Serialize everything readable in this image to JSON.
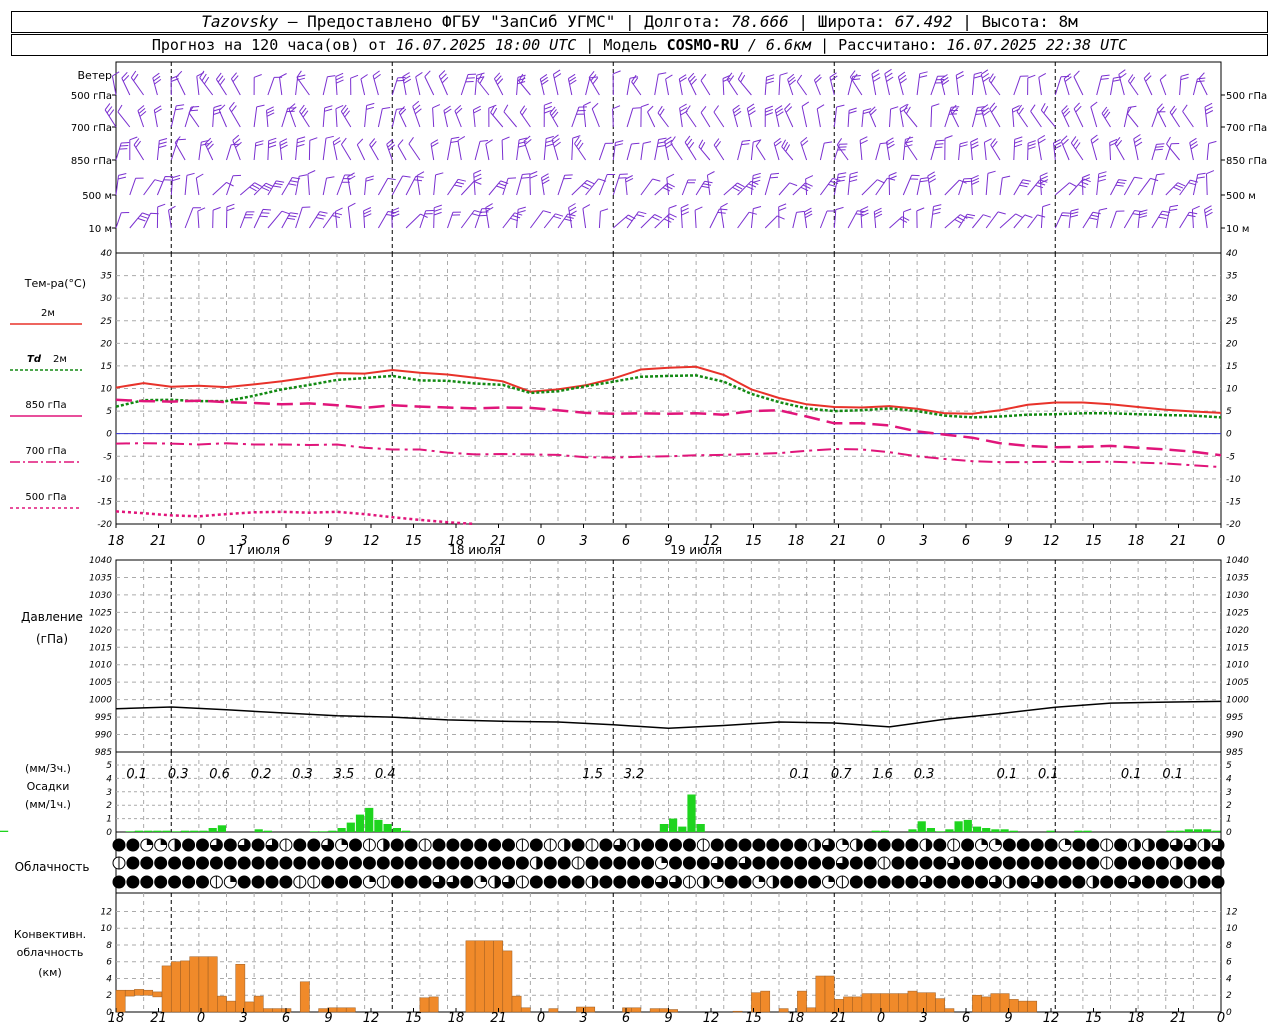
{
  "header": {
    "station": "Tazovsky",
    "provider": " — Предоставлено ФГБУ \"ЗапСиб УГМС\" | Долгота: ",
    "lon": "78.666",
    "lat_label": " | Широта: ",
    "lat": "67.492",
    "alt_label": " | Высота: 8м",
    "forecast_label": "Прогноз на 120 часа(ов) от ",
    "forecast_time": "16.07.2025 18:00 UTC",
    "model_label": " | Модель ",
    "model": "COSMO-RU",
    "model_res": " / 6.6км",
    "calc_label": " | Рассчитано: ",
    "calc_time": "16.07.2025 22:38 UTC"
  },
  "labels": {
    "wind": "Ветер",
    "wind_levels": [
      "500 гПа",
      "700 гПа",
      "850 гПа",
      "500 м",
      "10 м"
    ],
    "temp": "Тем-ра(°C)",
    "t2m": "2м",
    "td": "Td",
    "td2m": "2м",
    "t850": "850 гПа",
    "t700": "700 гПа",
    "t500": "500 гПа",
    "pressure": "Давление",
    "pressure_unit": "(гПа)",
    "precip_unit3": "(мм/3ч.)",
    "precip": "Осадки",
    "precip_unit1": "(мм/1ч.)",
    "cloud": "Облачность",
    "conv1": "Конвективн.",
    "conv2": "облачность",
    "conv3": "(км)"
  },
  "x_ticks": [
    "18",
    "21",
    "0",
    "3",
    "6",
    "9",
    "12",
    "15",
    "18",
    "21",
    "0",
    "3",
    "6",
    "9",
    "12",
    "15",
    "18",
    "21",
    "0",
    "3",
    "6",
    "9",
    "12",
    "15",
    "18",
    "21",
    "0"
  ],
  "days": [
    "17 июля",
    "18 июля",
    "19 июля"
  ],
  "colors": {
    "wind": "#7a2fd0",
    "t2m": "#e8322a",
    "td": "#138a13",
    "upper": "#e0157a",
    "precip": "#1ed41e",
    "conv": "#f08a2a",
    "zero": "#3030d0"
  },
  "chart_data": [
    {
      "type": "line",
      "title": "Тем-ра(°C)",
      "x_hours": [
        0,
        3,
        6,
        9,
        12,
        15,
        18,
        21,
        24,
        27,
        30,
        33,
        36,
        39,
        42,
        45,
        48,
        51,
        54,
        57,
        60,
        63,
        66,
        69,
        72,
        75,
        78,
        81,
        84,
        87,
        90,
        93,
        96,
        99,
        102,
        105,
        108,
        111,
        114,
        117,
        120
      ],
      "ylim": [
        -20,
        40
      ],
      "series": [
        {
          "name": "2м",
          "values": [
            10.2,
            11.2,
            10.4,
            10.6,
            10.3,
            10.9,
            11.6,
            12.5,
            13.4,
            13.3,
            14.1,
            13.5,
            13.1,
            12.4,
            11.6,
            9.3,
            9.8,
            10.7,
            12.2,
            14.2,
            14.6,
            14.8,
            13.0,
            9.8,
            7.9,
            6.5,
            5.9,
            5.8,
            6.1,
            5.5,
            4.5,
            4.4,
            5.2,
            6.4,
            6.9,
            6.9,
            6.5,
            5.9,
            5.3,
            4.9,
            4.6
          ]
        },
        {
          "name": "Td 2м",
          "values": [
            6.0,
            7.4,
            7.5,
            7.2,
            7.2,
            8.4,
            9.8,
            10.8,
            11.9,
            12.3,
            12.8,
            11.8,
            11.7,
            11.1,
            10.8,
            9.0,
            9.4,
            10.5,
            11.5,
            12.6,
            12.8,
            12.9,
            11.5,
            8.8,
            7.0,
            5.6,
            5.0,
            5.2,
            5.6,
            5.0,
            4.0,
            3.6,
            3.8,
            4.2,
            4.3,
            4.5,
            4.5,
            4.3,
            4.1,
            4.0,
            3.6
          ]
        },
        {
          "name": "850 гПа",
          "values": [
            7.5,
            7.2,
            7.1,
            7.3,
            7.0,
            6.8,
            6.5,
            6.7,
            6.3,
            5.7,
            6.3,
            6.0,
            5.8,
            5.6,
            5.8,
            5.7,
            5.2,
            4.6,
            4.4,
            4.5,
            4.4,
            4.5,
            4.2,
            5.0,
            5.2,
            3.8,
            2.3,
            2.3,
            1.8,
            0.5,
            -0.2,
            -0.9,
            -2.1,
            -2.7,
            -3.0,
            -2.9,
            -2.7,
            -3.1,
            -3.5,
            -4.0,
            -4.8
          ]
        },
        {
          "name": "700 гПа",
          "values": [
            -2.2,
            -2.1,
            -2.2,
            -2.4,
            -2.1,
            -2.4,
            -2.4,
            -2.5,
            -2.4,
            -3.1,
            -3.5,
            -3.5,
            -4.2,
            -4.6,
            -4.5,
            -4.6,
            -4.7,
            -5.2,
            -5.3,
            -5.1,
            -5.0,
            -4.8,
            -4.7,
            -4.5,
            -4.3,
            -3.8,
            -3.4,
            -3.5,
            -4.1,
            -5.0,
            -5.6,
            -6.1,
            -6.3,
            -6.3,
            -6.2,
            -6.3,
            -6.2,
            -6.4,
            -6.6,
            -7.0,
            -7.4
          ]
        },
        {
          "name": "500 гПа",
          "values": [
            -17.2,
            -17.6,
            -18.1,
            -18.3,
            -17.8,
            -17.4,
            -17.3,
            -17.5,
            -17.3,
            -17.8,
            -18.5,
            -19.1,
            -19.6,
            -20.0
          ]
        }
      ]
    },
    {
      "type": "line",
      "title": "Давление",
      "ylabel": "(гПа)",
      "x_hours": [
        0,
        6,
        12,
        18,
        24,
        30,
        36,
        42,
        48,
        54,
        60,
        66,
        72,
        78,
        84,
        90,
        96,
        102,
        108,
        114,
        120
      ],
      "ylim": [
        985,
        1040
      ],
      "series": [
        {
          "name": "Давление",
          "values": [
            997.4,
            997.9,
            997.1,
            996.2,
            995.4,
            995.0,
            994.2,
            993.8,
            993.6,
            992.8,
            991.8,
            992.6,
            993.6,
            993.3,
            992.2,
            994.4,
            996.0,
            997.8,
            999.0,
            999.3,
            999.5
          ]
        }
      ]
    },
    {
      "type": "bar",
      "title": "Осадки",
      "x_hours": [
        0,
        1,
        2,
        3,
        4,
        5,
        6,
        7,
        8,
        9,
        10,
        11,
        12,
        13,
        14,
        15,
        16,
        17,
        18,
        19,
        20,
        21,
        22,
        23,
        24,
        25,
        26,
        27,
        28,
        29,
        30,
        31,
        32,
        33,
        34,
        35,
        36,
        37,
        38,
        39,
        40,
        41,
        42,
        43,
        44,
        45,
        46,
        47,
        48,
        49,
        50,
        51,
        52,
        53,
        54,
        55,
        56,
        57,
        58,
        59,
        60,
        61,
        62,
        63,
        64,
        65,
        66,
        67,
        68,
        69,
        70,
        71,
        72,
        73,
        74,
        75,
        76,
        77,
        78,
        79,
        80,
        81,
        82,
        83,
        84,
        85,
        86,
        87,
        88,
        89,
        90,
        91,
        92,
        93,
        94,
        95,
        96,
        97,
        98,
        99,
        100,
        101,
        102,
        103,
        104,
        105,
        106,
        107,
        108,
        109,
        110,
        111,
        112,
        113,
        114,
        115,
        116,
        117,
        118,
        119
      ],
      "ylim": [
        0,
        5
      ],
      "values": [
        0,
        0.05,
        0.1,
        0.1,
        0.1,
        0.1,
        0.05,
        0.1,
        0.1,
        0.1,
        0.3,
        0.5,
        0,
        0,
        0,
        0.2,
        0.1,
        0,
        0,
        0,
        0,
        0.05,
        0.05,
        0.1,
        0.3,
        0.7,
        1.3,
        1.8,
        0.9,
        0.6,
        0.3,
        0.1,
        0,
        0,
        0,
        0,
        0,
        0,
        0,
        0,
        0,
        0,
        0,
        0,
        0,
        0,
        0,
        0,
        0,
        0,
        0,
        0,
        0,
        0,
        0,
        0,
        0,
        0,
        0,
        0.6,
        1.0,
        0.4,
        2.8,
        0.6,
        0,
        0,
        0,
        0,
        0,
        0,
        0,
        0,
        0,
        0,
        0,
        0,
        0,
        0,
        0,
        0,
        0,
        0,
        0.1,
        0.1,
        0,
        0,
        0.2,
        0.8,
        0.3,
        0.05,
        0.2,
        0.8,
        0.9,
        0.4,
        0.3,
        0.2,
        0.2,
        0.1,
        0,
        0,
        0,
        0.1,
        0,
        0,
        0.1,
        0.1,
        0,
        0,
        0,
        0,
        0,
        0,
        0,
        0,
        0.1,
        0.1,
        0.2,
        0.2,
        0.2,
        0.1,
        0.1,
        0
      ],
      "labels": [
        {
          "x_hours": 1.5,
          "text": "0.1"
        },
        {
          "x_hours": 4.5,
          "text": "0.3"
        },
        {
          "x_hours": 7.5,
          "text": "0.6"
        },
        {
          "x_hours": 10.5,
          "text": "0.2"
        },
        {
          "x_hours": 13.5,
          "text": "0.3"
        },
        {
          "x_hours": 16.5,
          "text": "3.5"
        },
        {
          "x_hours": 19.5,
          "text": "0.4"
        },
        {
          "x_hours": 34.5,
          "text": "1.5"
        },
        {
          "x_hours": 37.5,
          "text": "3.2"
        },
        {
          "x_hours": 49.5,
          "text": "0.1"
        },
        {
          "x_hours": 52.5,
          "text": "0.7"
        },
        {
          "x_hours": 55.5,
          "text": "1.6"
        },
        {
          "x_hours": 58.5,
          "text": "0.3"
        },
        {
          "x_hours": 64.5,
          "text": "0.1"
        },
        {
          "x_hours": 67.5,
          "text": "0.1"
        },
        {
          "x_hours": 73.5,
          "text": "0.1"
        },
        {
          "x_hours": 76.5,
          "text": "0.1"
        }
      ]
    },
    {
      "type": "bar",
      "title": "Конвективн. облачность",
      "ylabel": "(км)",
      "ylim": [
        0,
        13
      ],
      "x_hours": [
        0,
        1,
        2,
        3,
        4,
        5,
        6,
        7,
        8,
        9,
        10,
        11,
        12,
        13,
        14,
        15,
        16,
        17,
        18,
        19,
        20,
        21,
        22,
        23,
        24,
        25,
        26,
        27,
        28,
        29,
        30,
        31,
        32,
        33,
        34,
        35,
        36,
        37,
        38,
        39,
        40,
        41,
        42,
        43,
        44,
        45,
        46,
        47,
        48,
        49,
        50,
        51,
        52,
        53,
        54,
        55,
        56,
        57,
        58,
        59,
        60,
        61,
        62,
        63,
        64,
        65,
        66,
        67,
        68,
        69,
        70,
        71,
        72,
        73,
        74,
        75,
        76,
        77,
        78,
        79,
        80,
        81,
        82,
        83,
        84,
        85,
        86,
        87,
        88,
        89,
        90,
        91,
        92,
        93,
        94,
        95,
        96,
        97,
        98,
        99,
        100,
        101,
        102,
        103,
        104,
        105,
        106,
        107,
        108,
        109,
        110,
        111,
        112,
        113,
        114,
        115,
        116,
        117,
        118,
        119
      ],
      "bases": [
        0,
        1.9,
        2.0,
        2.0,
        1.8,
        0,
        0,
        0,
        0,
        0,
        0,
        0,
        0,
        0,
        0,
        0,
        0,
        0,
        0,
        0,
        0,
        0,
        0,
        0,
        0,
        0,
        0,
        0,
        0,
        0,
        0,
        0,
        0,
        0,
        0,
        0,
        0,
        0,
        0,
        0,
        0,
        0,
        0,
        0,
        0,
        0,
        0,
        0,
        0,
        0,
        0,
        0,
        0,
        0,
        0,
        0,
        0,
        0,
        0,
        0,
        0,
        0,
        0,
        0,
        0,
        0,
        0,
        0,
        0,
        0,
        0,
        0,
        0,
        0,
        0,
        0,
        0,
        0,
        0,
        0,
        0,
        0,
        0,
        0,
        0,
        0,
        0,
        0,
        0,
        0,
        0,
        0,
        0,
        0,
        0,
        0,
        0,
        0,
        0,
        0,
        0,
        0,
        0,
        0,
        0,
        0,
        0,
        0,
        0,
        0,
        0,
        0,
        0,
        0,
        0,
        0,
        0,
        0,
        0,
        0
      ],
      "tops": [
        2.6,
        2.6,
        2.7,
        2.6,
        2.4,
        5.5,
        6.0,
        6.1,
        6.6,
        6.6,
        6.6,
        1.9,
        1.3,
        5.7,
        1.2,
        1.9,
        0.4,
        0.4,
        0.4,
        0,
        3.6,
        0,
        0.4,
        0.5,
        0.5,
        0.5,
        0,
        0,
        0,
        0,
        0,
        0,
        0,
        1.7,
        1.8,
        0,
        0,
        0,
        8.5,
        8.5,
        8.5,
        8.5,
        7.3,
        1.9,
        0.5,
        0,
        0,
        0.4,
        0,
        0,
        0.6,
        0.6,
        0,
        0,
        0,
        0.5,
        0.5,
        0,
        0.4,
        0.4,
        0.3,
        0,
        0,
        0,
        0,
        0,
        0,
        0.1,
        0,
        2.3,
        2.5,
        0,
        0.4,
        0,
        2.5,
        0.5,
        4.3,
        4.3,
        1.5,
        1.8,
        1.8,
        2.2,
        2.2,
        2.2,
        2.2,
        2.2,
        2.5,
        2.3,
        2.3,
        1.6,
        0.4,
        0,
        0,
        2.0,
        1.8,
        2.2,
        2.2,
        1.5,
        1.3,
        1.3,
        0,
        0,
        0,
        0,
        0,
        0,
        0,
        0,
        0,
        0,
        0,
        0,
        0,
        0,
        0,
        0,
        0,
        0,
        0,
        0
      ]
    }
  ]
}
